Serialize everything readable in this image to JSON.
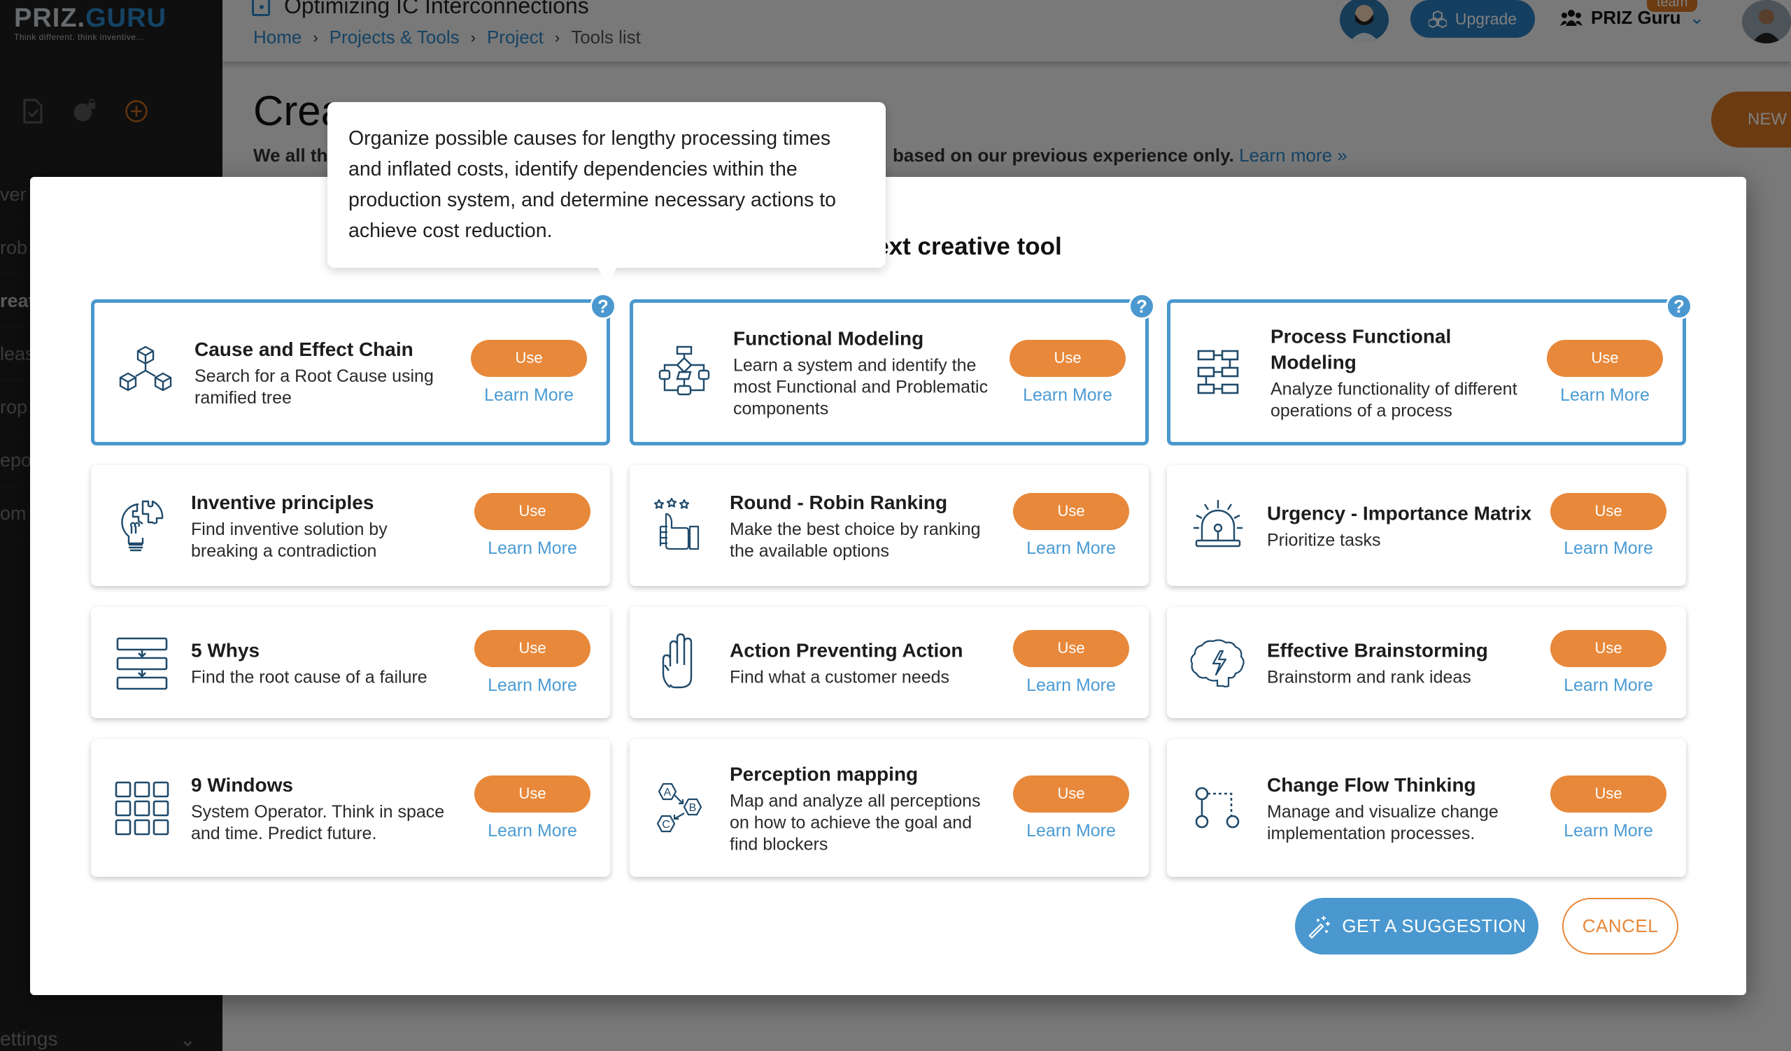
{
  "app": {
    "logo_main": "PRIZ.",
    "logo_accent": "GURU",
    "logo_tagline": "Think different. think inventive..."
  },
  "sidebar": {
    "icons": [
      "file-check-icon",
      "globe-lock-icon",
      "add-circle-icon"
    ],
    "items": [
      {
        "label": "ver"
      },
      {
        "label": "rob"
      },
      {
        "label": "reat",
        "active": true
      },
      {
        "label": "leas"
      },
      {
        "label": "rop"
      },
      {
        "label": "epo"
      },
      {
        "label": "om"
      }
    ],
    "settings_label": "ettings"
  },
  "header": {
    "project_title": "Optimizing IC Interconnections",
    "breadcrumb": [
      "Home",
      "Projects & Tools",
      "Project",
      "Tools list"
    ],
    "upgrade_label": "Upgrade",
    "team_name": "PRIZ Guru",
    "team_badge": "team"
  },
  "page": {
    "title": "Crea",
    "intro_start": "We all th",
    "intro_end": "based on our previous experience only.",
    "learn_more_link": "Learn more »",
    "new_button": "NEW"
  },
  "modal": {
    "title_visible": "ext creative tool",
    "tools": [
      {
        "title": "Cause and Effect Chain",
        "desc": "Search for a Root Cause using ramified tree",
        "icon": "cubes-tree-icon",
        "featured": true
      },
      {
        "title": "Functional Modeling",
        "desc": "Learn a system and identify the most Functional and Problematic components",
        "icon": "flowchart-icon",
        "featured": true
      },
      {
        "title": "Process Functional Modeling",
        "desc": "Analyze functionality of different operations of a process",
        "icon": "process-blocks-icon",
        "featured": true
      },
      {
        "title": "Inventive principles",
        "desc": "Find inventive solution by breaking a contradiction",
        "icon": "lightbulb-puzzle-icon"
      },
      {
        "title": "Round - Robin Ranking",
        "desc": "Make the best choice by ranking the available options",
        "icon": "thumbs-up-stars-icon"
      },
      {
        "title": "Urgency - Importance Matrix",
        "desc": "Prioritize tasks",
        "icon": "siren-icon"
      },
      {
        "title": "5 Whys",
        "desc": "Find the root cause of a failure",
        "icon": "stacked-steps-icon"
      },
      {
        "title": "Action Preventing Action",
        "desc": "Find what a customer needs",
        "icon": "hand-stop-icon"
      },
      {
        "title": "Effective Brainstorming",
        "desc": "Brainstorm and rank ideas",
        "icon": "brain-lightning-icon"
      },
      {
        "title": "9 Windows",
        "desc": "System Operator. Think in space and time. Predict future.",
        "icon": "nine-grid-icon"
      },
      {
        "title": "Perception mapping",
        "desc": "Map and analyze all perceptions on how to achieve the goal and find blockers",
        "icon": "abc-hexagons-icon"
      },
      {
        "title": "Change Flow Thinking",
        "desc": "Manage and visualize change implementation processes.",
        "icon": "flow-nodes-icon"
      }
    ],
    "use_label": "Use",
    "learn_more_label": "Learn More",
    "help_label": "?",
    "suggest_label": "GET A SUGGESTION",
    "cancel_label": "CANCEL"
  },
  "tooltip": {
    "text": "Organize possible causes for lengthy processing times and inflated costs, identify dependencies within the production system, and determine necessary actions to achieve cost reduction."
  },
  "colors": {
    "accent_orange": "#e8883a",
    "accent_blue": "#4a98cf",
    "icon_navy": "#1f4a6b",
    "sidebar_bg": "#1e1e1e"
  }
}
